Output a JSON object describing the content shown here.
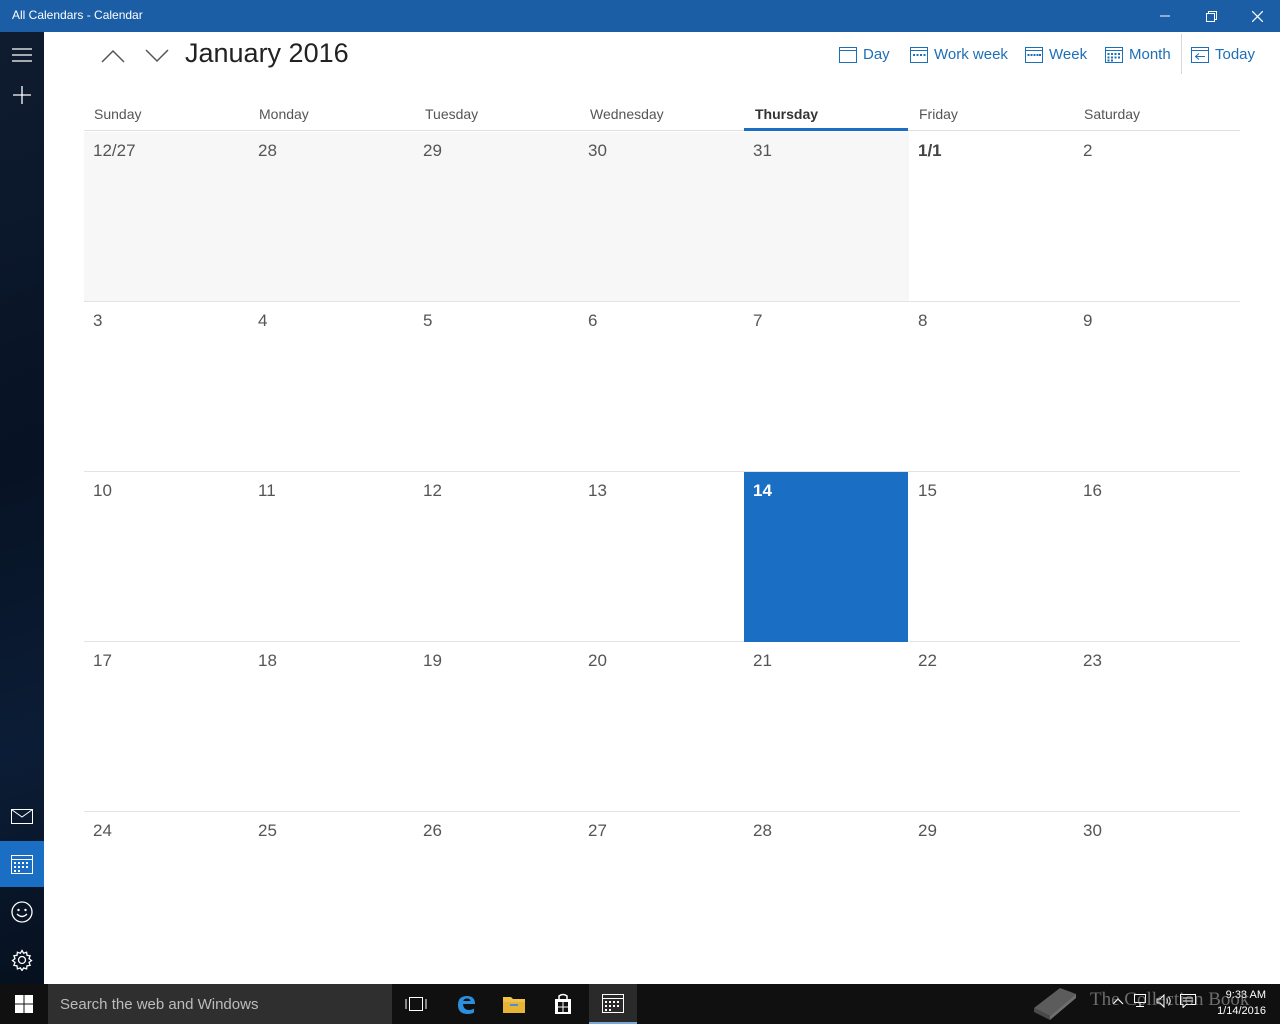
{
  "window": {
    "title": "All Calendars - Calendar"
  },
  "header": {
    "month_title": "January 2016",
    "views": [
      {
        "label": "Day",
        "icon": "day-view-icon"
      },
      {
        "label": "Work week",
        "icon": "work-week-icon"
      },
      {
        "label": "Week",
        "icon": "week-view-icon"
      },
      {
        "label": "Month",
        "icon": "month-view-icon"
      },
      {
        "label": "Today",
        "icon": "today-icon"
      }
    ]
  },
  "weekdays": [
    "Sunday",
    "Monday",
    "Tuesday",
    "Wednesday",
    "Thursday",
    "Friday",
    "Saturday"
  ],
  "today_weekday": "Thursday",
  "weeks": [
    [
      "12/27",
      "28",
      "29",
      "30",
      "31",
      "1/1",
      "2"
    ],
    [
      "3",
      "4",
      "5",
      "6",
      "7",
      "8",
      "9"
    ],
    [
      "10",
      "11",
      "12",
      "13",
      "14",
      "15",
      "16"
    ],
    [
      "17",
      "18",
      "19",
      "20",
      "21",
      "22",
      "23"
    ],
    [
      "24",
      "25",
      "26",
      "27",
      "28",
      "29",
      "30"
    ]
  ],
  "today_date": "14",
  "rail": {
    "top": [
      "hamburger-menu-icon",
      "new-event-icon"
    ],
    "bottom": [
      "mail-icon",
      "calendar-icon",
      "people-icon",
      "settings-icon"
    ],
    "active": "calendar-icon"
  },
  "taskbar": {
    "search_placeholder": "Search the web and Windows",
    "apps": [
      "task-view-icon",
      "edge-icon",
      "file-explorer-icon",
      "store-icon",
      "calendar-app-icon"
    ],
    "active_app": "calendar-app-icon",
    "clock_time": "9:33 AM",
    "clock_date": "1/14/2016",
    "watermark": "The Collection Book"
  },
  "colors": {
    "titlebar": "#1b5ea6",
    "accent": "#1a6fc4",
    "link": "#1d6fb8",
    "prev_month_bg": "#f7f7f7"
  }
}
